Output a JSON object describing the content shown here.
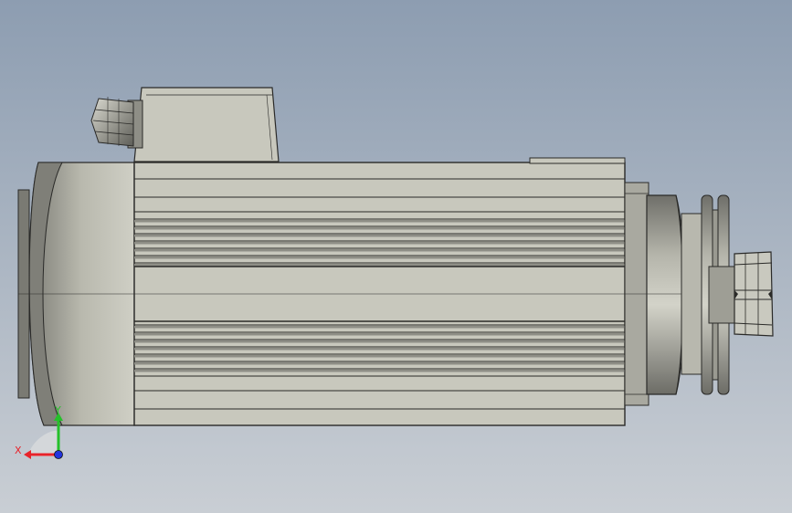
{
  "viewport": {
    "background_top": "#8d9db1",
    "background_bottom": "#c9ced4"
  },
  "model": {
    "body_color": "#c8c8bd",
    "dark_color": "#8e8e86",
    "edge_color": "#2a2a28"
  },
  "triad": {
    "x_label": "X",
    "y_label": "Y",
    "x_color": "#e8232a",
    "y_color": "#25c02a",
    "z_color": "#2233dd"
  }
}
